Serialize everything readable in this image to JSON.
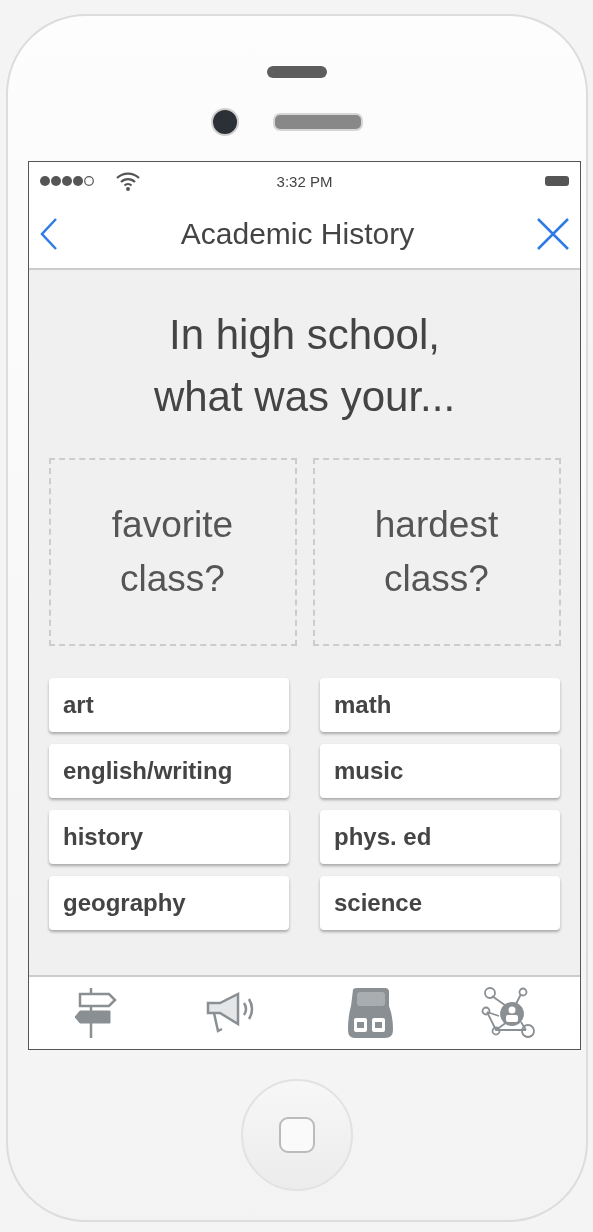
{
  "status_bar": {
    "time": "3:32 PM"
  },
  "header": {
    "title": "Academic History"
  },
  "question": "In high school, what was your...",
  "drop_zones": [
    {
      "label": "favorite class?"
    },
    {
      "label": "hardest class?"
    }
  ],
  "options": [
    {
      "label": "art"
    },
    {
      "label": "math"
    },
    {
      "label": "english/writing"
    },
    {
      "label": "music"
    },
    {
      "label": "history"
    },
    {
      "label": "phys. ed"
    },
    {
      "label": "geography"
    },
    {
      "label": "science"
    }
  ]
}
